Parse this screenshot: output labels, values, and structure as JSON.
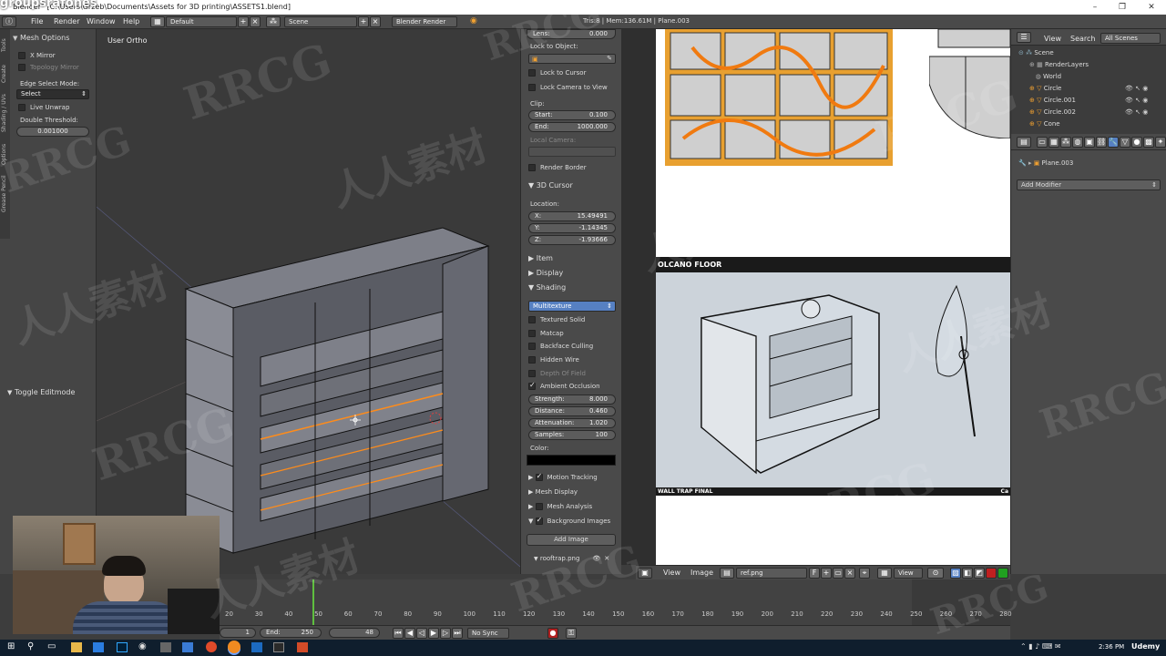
{
  "window": {
    "title": "Blender* [C:\\Users\\Grzeb\\Documents\\Assets for 3D printing\\ASSETS1.blend]",
    "watermark_top": "groupsrafones",
    "controls": [
      "–",
      "❐",
      "✕"
    ]
  },
  "menubar": {
    "items": [
      "File",
      "Render",
      "Window",
      "Help"
    ],
    "layout": "Default",
    "scene": "Scene",
    "engine": "Blender Render",
    "stats": "Tris:8 | Mem:136.61M | Plane.003"
  },
  "toolshelf": {
    "tabs": [
      "Tools",
      "Create",
      "Shading / UVs",
      "Options",
      "Grease Pencil"
    ],
    "mesh_options_title": "Mesh Options",
    "x_mirror": "X Mirror",
    "topology_mirror": "Topology Mirror",
    "edge_select_mode_label": "Edge Select Mode:",
    "edge_select_mode_value": "Select",
    "live_unwrap": "Live Unwrap",
    "double_threshold_label": "Double Threshold:",
    "double_threshold_value": "0.001000",
    "toggle_editmode": "Toggle Editmode"
  },
  "viewport": {
    "label": "User Ortho"
  },
  "npanel": {
    "lens_label": "Lens:",
    "lens_value": "0.000",
    "lock_to_object": "Lock to Object:",
    "lock_to_cursor": "Lock to Cursor",
    "lock_camera": "Lock Camera to View",
    "clip": "Clip:",
    "clip_start_label": "Start:",
    "clip_start": "0.100",
    "clip_end_label": "End:",
    "clip_end": "1000.000",
    "local_camera": "Local Camera:",
    "render_border": "Render Border",
    "cursor_title": "3D Cursor",
    "location": "Location:",
    "x_label": "X:",
    "x": "15.49491",
    "y_label": "Y:",
    "y": "-1.14345",
    "z_label": "Z:",
    "z": "-1.93666",
    "item": "Item",
    "display": "Display",
    "shading": "Shading",
    "shading_mode": "Multitexture",
    "textured_solid": "Textured Solid",
    "matcap": "Matcap",
    "backface_culling": "Backface Culling",
    "hidden_wire": "Hidden Wire",
    "depth_of_field": "Depth Of Field",
    "ambient_occlusion": "Ambient Occlusion",
    "strength_label": "Strength:",
    "strength": "8.000",
    "distance_label": "Distance:",
    "distance": "0.460",
    "attenuation_label": "Attenuation:",
    "attenuation": "1.020",
    "samples_label": "Samples:",
    "samples": "100",
    "color": "Color:",
    "motion_tracking": "Motion Tracking",
    "mesh_display": "Mesh Display",
    "mesh_analysis": "Mesh Analysis",
    "background_images": "Background Images",
    "add_image": "Add Image",
    "image_name": "rooftrap.png"
  },
  "image_editor": {
    "caption_top": "OLCANO FLOOR",
    "caption_bottom": "WALL TRAP FINAL",
    "caption_bottom_right": "Ca",
    "header_view": "View",
    "header_image": "Image",
    "image_name": "ref.png",
    "f_label": "F",
    "view_dd": "View"
  },
  "outliner": {
    "view": "View",
    "search": "Search",
    "all_scenes": "All Scenes",
    "items": [
      "Scene",
      "RenderLayers",
      "World",
      "Circle",
      "Circle.001",
      "Circle.002",
      "Cone"
    ]
  },
  "properties": {
    "object": "Plane.003",
    "add_modifier": "Add Modifier"
  },
  "timeline": {
    "ticks": [
      "20",
      "30",
      "40",
      "50",
      "60",
      "70",
      "80",
      "90",
      "100",
      "110",
      "120",
      "130",
      "140",
      "150",
      "160",
      "170",
      "180",
      "190",
      "200",
      "210",
      "220",
      "230",
      "240",
      "250",
      "260",
      "270",
      "280"
    ],
    "start": "1",
    "end_label": "End:",
    "end": "250",
    "current": "48",
    "sync": "No Sync"
  },
  "taskbar": {
    "time": "2:36 PM",
    "brand": "Udemy"
  },
  "watermarks": [
    "RRCG",
    "人人素材",
    "RRCG",
    "人人素材",
    "RRCG",
    "RRCG",
    "人人素材",
    "RRCG",
    "RRCG",
    "人人素材",
    "RRCG",
    "人人素材",
    "RRCG",
    "RRCG"
  ],
  "colors": {
    "ui_bg": "#4a4a4a",
    "viewport_bg": "#3a3a3a",
    "accent_blue": "#5680c2",
    "selection_orange": "#ff8c1a",
    "taskbar": "#0f1e2d"
  }
}
